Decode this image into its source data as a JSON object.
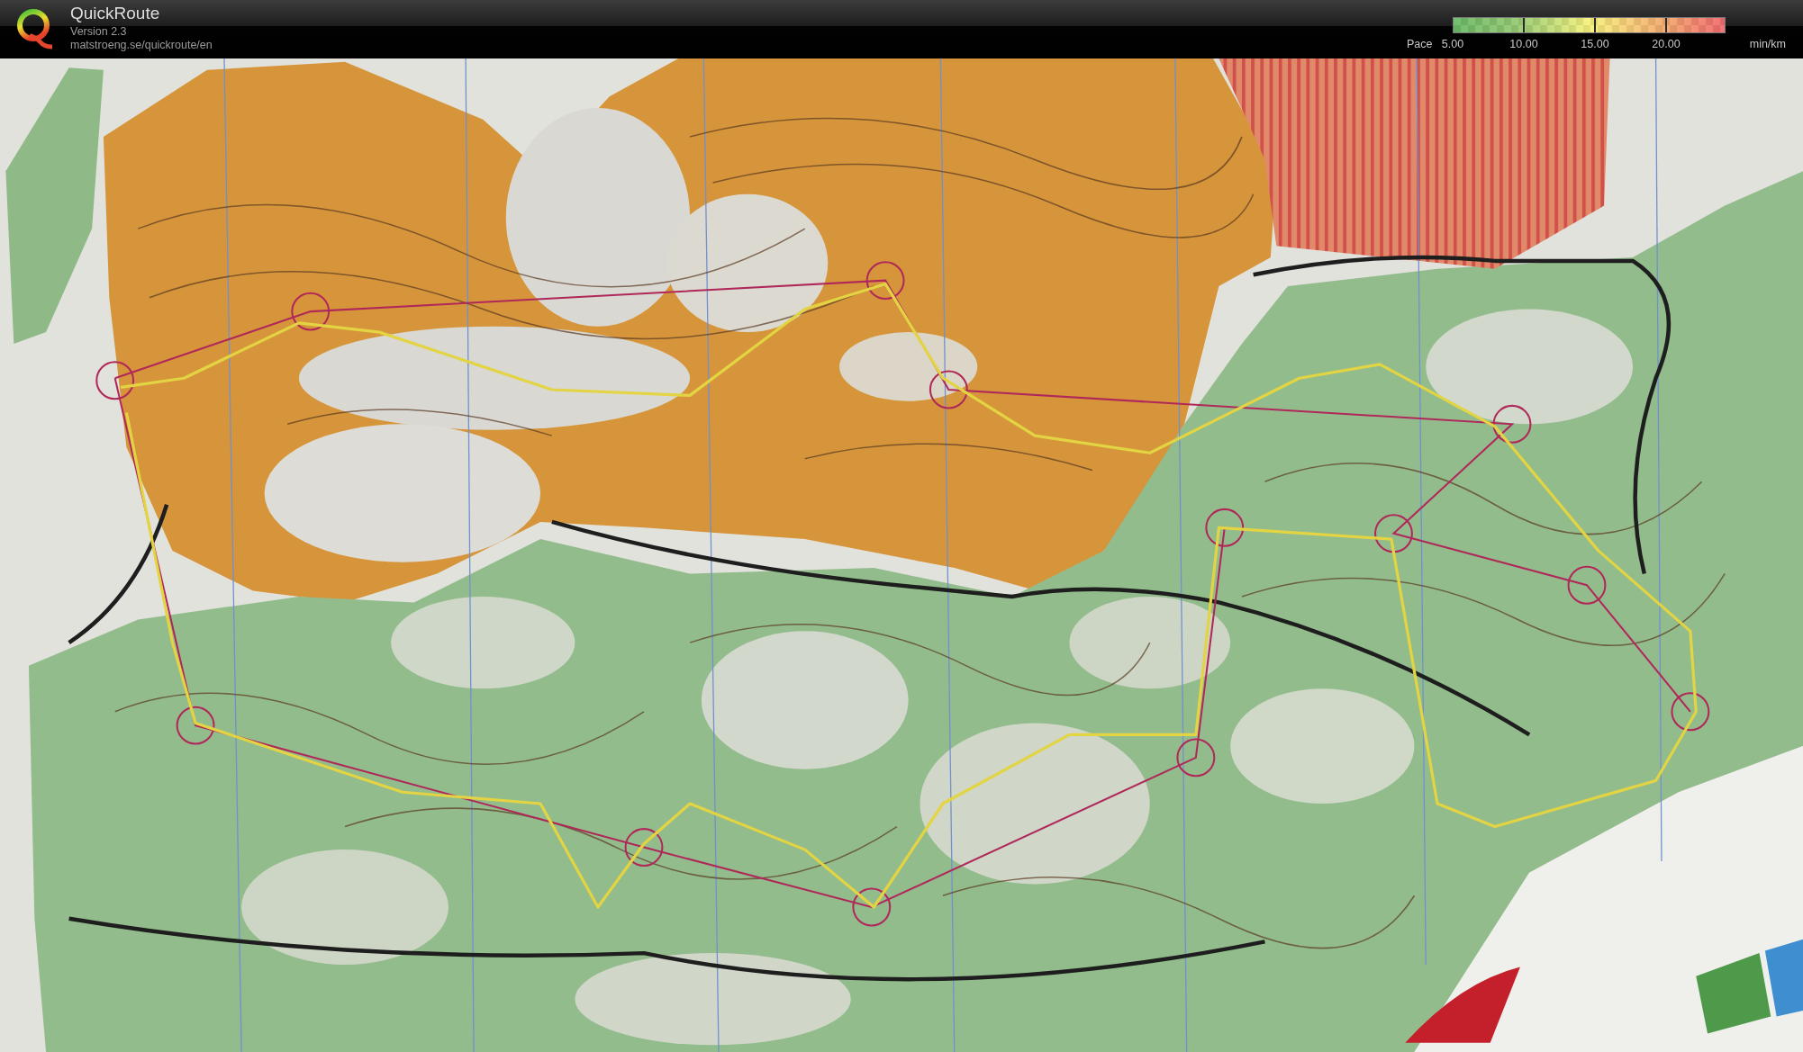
{
  "app": {
    "title": "QuickRoute",
    "version": "Version 2.3",
    "url": "matstroeng.se/quickroute/en"
  },
  "pace_legend": {
    "label": "Pace",
    "ticks": [
      "5.00",
      "10.00",
      "15.00",
      "20.00"
    ],
    "unit": "min/km"
  }
}
